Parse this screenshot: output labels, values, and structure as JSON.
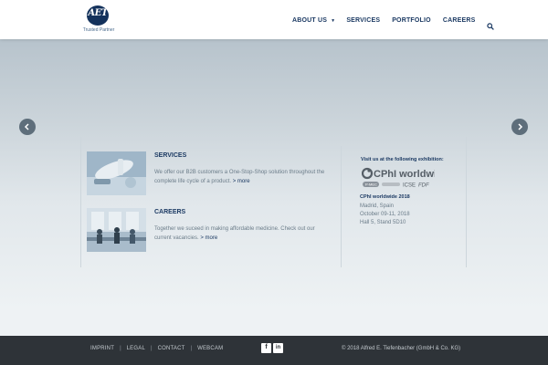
{
  "header": {
    "logo": {
      "mark": "AET",
      "tagline": "Trusted Partner"
    },
    "nav": [
      {
        "label": "ABOUT US",
        "has_dropdown": true
      },
      {
        "label": "SERVICES"
      },
      {
        "label": "PORTFOLIO"
      },
      {
        "label": "CAREERS"
      }
    ],
    "search_icon": "search-icon"
  },
  "slider": {
    "prev_icon": "chevron-left-icon",
    "next_icon": "chevron-right-icon"
  },
  "content": {
    "services": {
      "title": "SERVICES",
      "text": "We offer our B2B customers a One-Stop-Shop solution throughout the complete life cycle of a product.",
      "more": "> more"
    },
    "careers": {
      "title": "CAREERS",
      "text": "Together we suceed in making affordable medicine. Check out our current vacancies.",
      "more": "> more"
    },
    "exhibition": {
      "heading": "Visit us at the following exhibition:",
      "logo_text": "CPhI worldwide",
      "logo_partners": [
        "P-MEC",
        "ICSE",
        "FDF"
      ],
      "title": "CPhI  worldwide 2018",
      "city": "Madrid, Spain",
      "dates": "October 09-11, 2018",
      "stand": "Hall 5, Stand 5D10"
    }
  },
  "footer": {
    "links": [
      "IMPRINT",
      "LEGAL",
      "CONTACT",
      "WEBCAM"
    ],
    "separator": "|",
    "social": [
      {
        "icon": "facebook-icon",
        "glyph": "f"
      },
      {
        "icon": "linkedin-icon",
        "glyph": "in"
      }
    ],
    "copyright": "© 2018 Alfred E. Tiefenbacher (GmbH & Co. KG)"
  },
  "colors": {
    "brand_navy": "#1c3a63",
    "footer_bg": "#2e3338",
    "arrow_bg": "#5e6e7b"
  }
}
